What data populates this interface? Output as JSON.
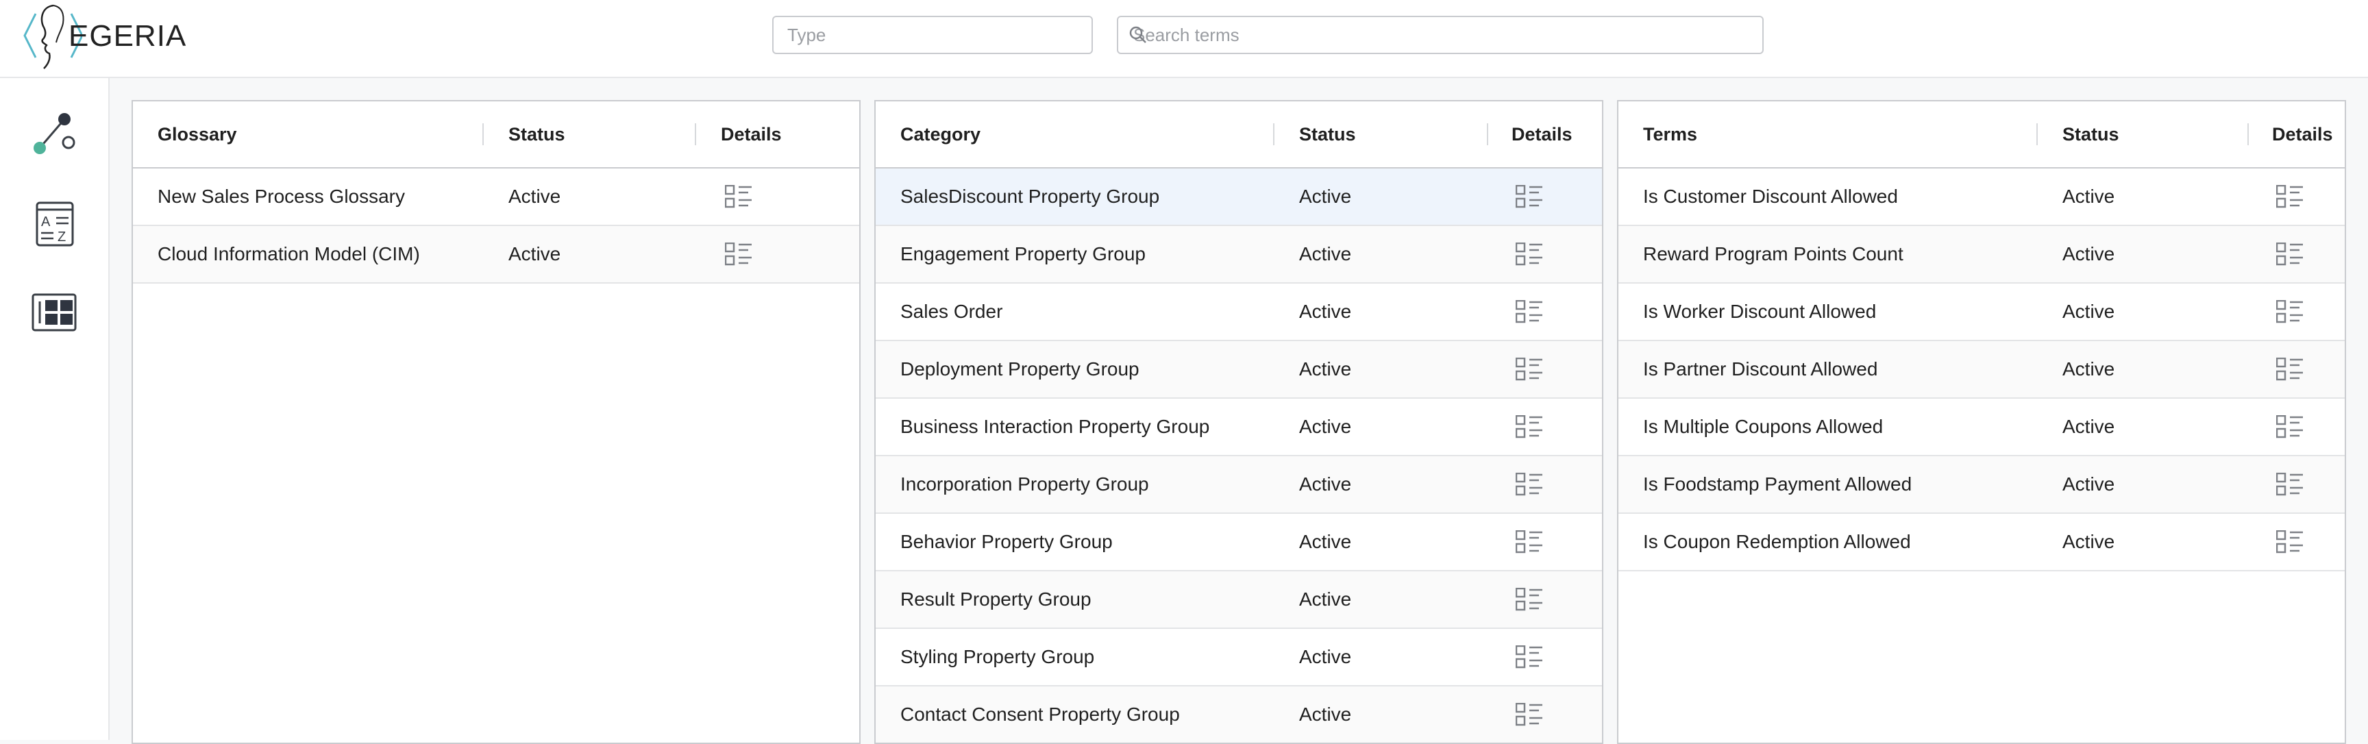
{
  "app": {
    "logo_text": "EGERIA"
  },
  "header": {
    "type_placeholder": "Type",
    "search_placeholder": "Search terms"
  },
  "sidebar": {
    "items": [
      {
        "name": "glossary-graph",
        "icon": "graph-nodes-icon"
      },
      {
        "name": "glossary-az",
        "icon": "a-z-list-icon"
      },
      {
        "name": "glossary-tiles",
        "icon": "tile-grid-icon"
      }
    ]
  },
  "glossary_panel": {
    "columns": [
      "Glossary",
      "Status",
      "Details"
    ],
    "rows": [
      {
        "name": "New Sales Process Glossary",
        "status": "Active"
      },
      {
        "name": "Cloud Information Model (CIM)",
        "status": "Active"
      }
    ]
  },
  "category_panel": {
    "columns": [
      "Category",
      "Status",
      "Details"
    ],
    "selected_index": 0,
    "rows": [
      {
        "name": "SalesDiscount Property Group",
        "status": "Active"
      },
      {
        "name": "Engagement Property Group",
        "status": "Active"
      },
      {
        "name": "Sales Order",
        "status": "Active"
      },
      {
        "name": "Deployment Property Group",
        "status": "Active"
      },
      {
        "name": "Business Interaction Property Group",
        "status": "Active"
      },
      {
        "name": "Incorporation Property Group",
        "status": "Active"
      },
      {
        "name": "Behavior Property Group",
        "status": "Active"
      },
      {
        "name": "Result Property Group",
        "status": "Active"
      },
      {
        "name": "Styling Property Group",
        "status": "Active"
      },
      {
        "name": "Contact Consent Property Group",
        "status": "Active"
      }
    ]
  },
  "terms_panel": {
    "columns": [
      "Terms",
      "Status",
      "Details"
    ],
    "rows": [
      {
        "name": "Is Customer Discount Allowed",
        "status": "Active"
      },
      {
        "name": "Reward Program Points Count",
        "status": "Active"
      },
      {
        "name": "Is Worker Discount Allowed",
        "status": "Active"
      },
      {
        "name": "Is Partner Discount Allowed",
        "status": "Active"
      },
      {
        "name": "Is Multiple Coupons Allowed",
        "status": "Active"
      },
      {
        "name": "Is Foodstamp Payment Allowed",
        "status": "Active"
      },
      {
        "name": "Is Coupon Redemption Allowed",
        "status": "Active"
      }
    ]
  },
  "colors": {
    "accent_green": "#4fb39a",
    "selected_row": "#eef4fc",
    "logo_teal": "#56b7c9"
  }
}
